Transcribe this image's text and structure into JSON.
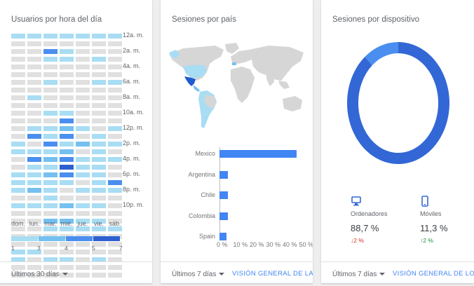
{
  "users_card": {
    "title": "Usuarios por hora del día",
    "hours": [
      "12a. m.",
      "2a. m.",
      "4a. m.",
      "6a. m.",
      "8a. m.",
      "10a. m.",
      "12p. m.",
      "2p. m.",
      "4p. m.",
      "6p. m.",
      "8p. m.",
      "10p. m."
    ],
    "days": [
      "dom.",
      "lun.",
      "mar.",
      "mié.",
      "jue.",
      "vie.",
      "sáb."
    ],
    "legend": [
      "1",
      "3",
      "4",
      "5",
      "7"
    ],
    "footer_range": "Últimos 30 días",
    "colors": [
      "#e0e0e0",
      "#a8ddf3",
      "#74c0f0",
      "#4a8ef0",
      "#2e5fd0",
      "#1e3fa0"
    ],
    "heat_levels": [
      [
        1,
        1,
        1,
        1,
        1,
        1,
        1
      ],
      [
        0,
        0,
        0,
        0,
        0,
        0,
        0
      ],
      [
        0,
        0,
        3,
        1,
        0,
        0,
        0
      ],
      [
        0,
        0,
        1,
        1,
        0,
        1,
        0
      ],
      [
        0,
        0,
        0,
        0,
        0,
        0,
        0
      ],
      [
        0,
        0,
        0,
        0,
        0,
        0,
        0
      ],
      [
        0,
        0,
        1,
        0,
        0,
        1,
        1
      ],
      [
        0,
        0,
        0,
        0,
        0,
        0,
        0
      ],
      [
        0,
        1,
        0,
        0,
        0,
        0,
        0
      ],
      [
        0,
        0,
        0,
        0,
        0,
        0,
        0
      ],
      [
        0,
        0,
        1,
        1,
        0,
        0,
        0
      ],
      [
        0,
        0,
        0,
        3,
        0,
        0,
        0
      ],
      [
        0,
        1,
        1,
        2,
        1,
        0,
        1
      ],
      [
        0,
        3,
        1,
        3,
        0,
        1,
        0
      ],
      [
        1,
        0,
        3,
        1,
        2,
        1,
        1
      ],
      [
        1,
        1,
        1,
        2,
        0,
        1,
        0
      ],
      [
        0,
        3,
        2,
        3,
        1,
        1,
        1
      ],
      [
        0,
        1,
        1,
        4,
        1,
        1,
        0
      ],
      [
        1,
        1,
        2,
        3,
        1,
        1,
        0
      ],
      [
        1,
        1,
        1,
        1,
        0,
        1,
        3
      ],
      [
        1,
        2,
        1,
        0,
        1,
        1,
        1
      ],
      [
        0,
        0,
        1,
        0,
        0,
        0,
        0
      ],
      [
        1,
        1,
        1,
        2,
        1,
        1,
        0
      ],
      [
        0,
        0,
        0,
        0,
        0,
        0,
        0
      ],
      [
        0,
        0,
        2,
        2,
        1,
        1,
        0
      ],
      [
        0,
        0,
        1,
        1,
        1,
        1,
        1
      ],
      [
        0,
        0,
        0,
        0,
        0,
        0,
        0
      ],
      [
        0,
        0,
        0,
        0,
        0,
        0,
        0
      ],
      [
        1,
        1,
        0,
        0,
        0,
        0,
        0
      ],
      [
        1,
        0,
        1,
        1,
        0,
        1,
        0
      ],
      [
        0,
        0,
        0,
        0,
        0,
        0,
        0
      ],
      [
        0,
        0,
        0,
        0,
        0,
        0,
        0
      ]
    ]
  },
  "country_card": {
    "title": "Sesiones por país",
    "footer_range": "Últimos 7 días",
    "footer_link": "VISIÓN GENERAL DE LAS UBI",
    "map_colors": {
      "land": "#d6d6d6",
      "mexico": "#1e5bd0",
      "us": "#a8ddf3",
      "mid": "#74c0f0"
    },
    "chart_data": {
      "type": "bar",
      "categories": [
        "Mexico",
        "Argentina",
        "Chile",
        "Colombia",
        "Spain"
      ],
      "values": [
        46,
        5,
        5,
        5,
        4
      ],
      "ylabel": "",
      "xlabel": "",
      "ticks": [
        "0 %",
        "10 %",
        "20 %",
        "30 %",
        "40 %",
        "50 %"
      ],
      "xlim": [
        0,
        50
      ],
      "color": "#4285f4"
    }
  },
  "device_card": {
    "title": "Sesiones por dispositivo",
    "footer_range": "Últimos 7 días",
    "footer_link": "VISIÓN GENERAL DE LOS MÓ",
    "desktop": {
      "label": "Ordenadores",
      "value": "88,7 %",
      "change": "2 %",
      "arrow": "↓",
      "color": "#d93025"
    },
    "mobile": {
      "label": "Móviles",
      "value": "11,3 %",
      "change": "2 %",
      "arrow": "↑",
      "color": "#1e8e3e"
    },
    "chart_data": {
      "type": "pie",
      "categories": [
        "Ordenadores",
        "Móviles"
      ],
      "values": [
        88.7,
        11.3
      ],
      "colors": [
        "#3367d6",
        "#4a8ef0"
      ]
    }
  }
}
